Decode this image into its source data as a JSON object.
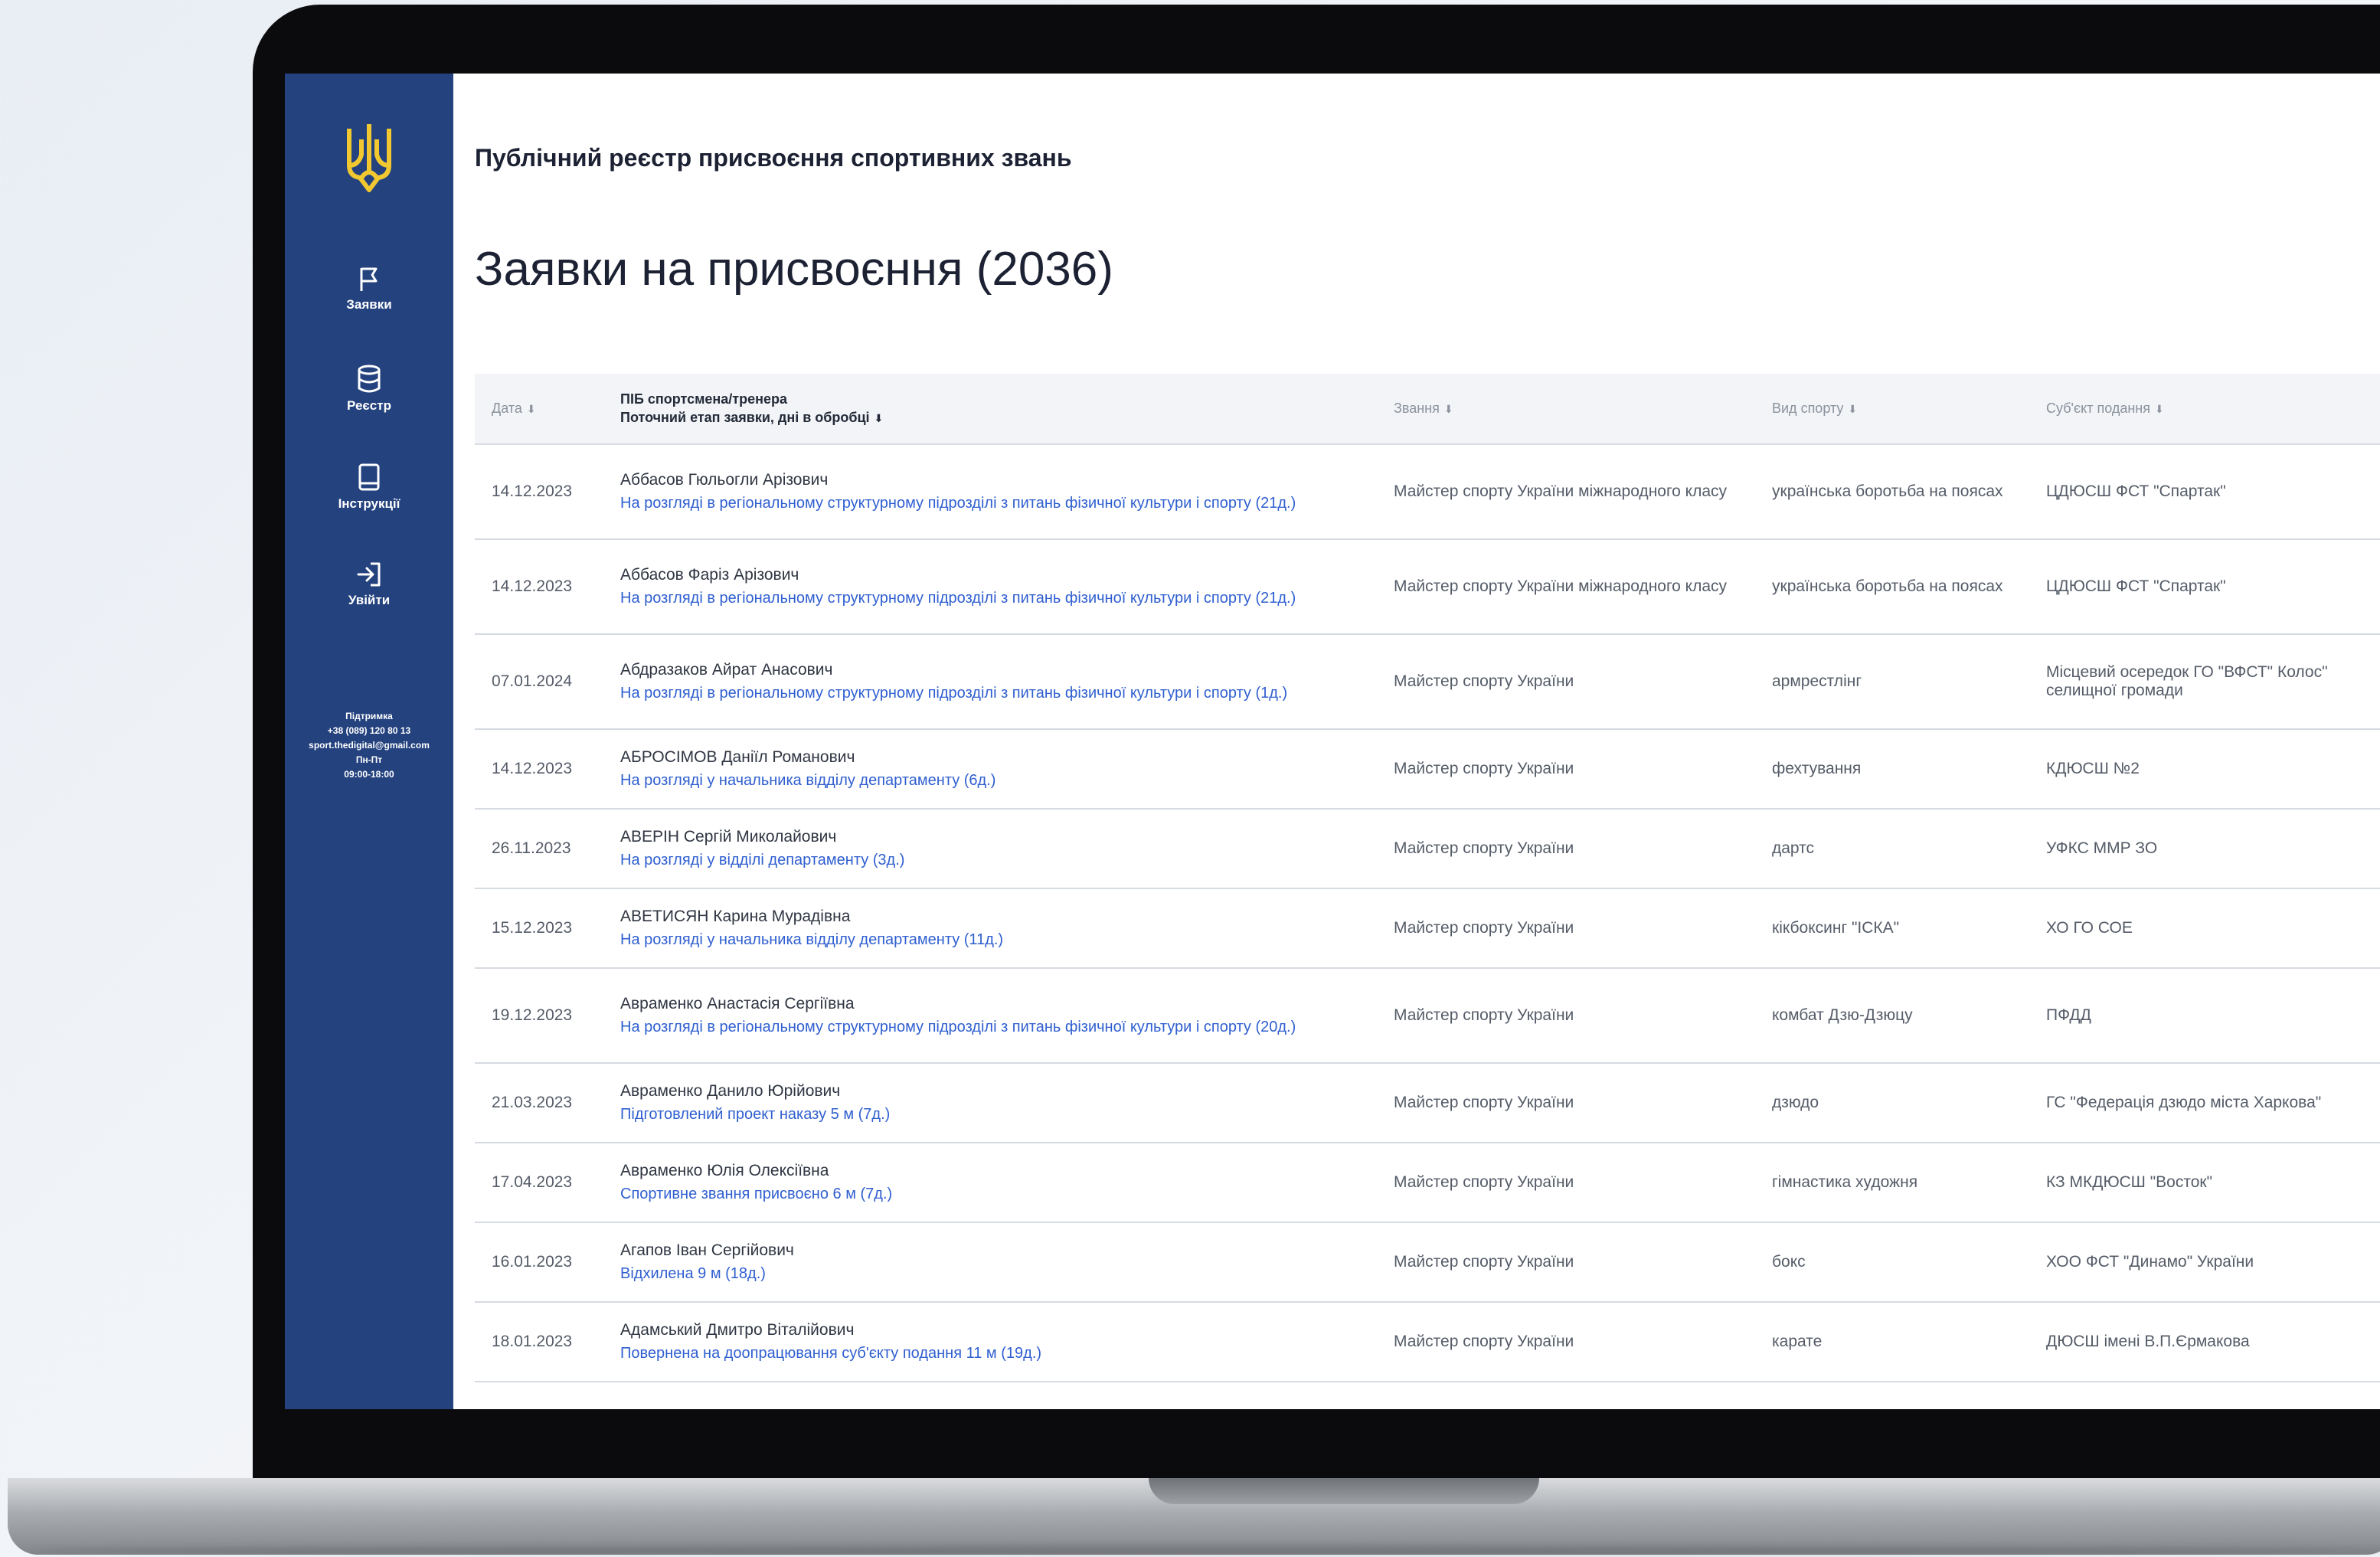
{
  "app": {
    "portal_title": "Публічний реєстр присвоєння спортивних звань",
    "page_title": "Заявки на присвоєння (2036)"
  },
  "colors": {
    "sidebar": "#24427e",
    "logo": "#f2c830",
    "link": "#2f5fd0",
    "header_bg": "#f2f4f7"
  },
  "sidebar": {
    "logo": "coat-of-arms-icon",
    "items": [
      {
        "label": "Заявки",
        "icon": "flag-icon"
      },
      {
        "label": "Реєстр",
        "icon": "database-icon"
      },
      {
        "label": "Інструкції",
        "icon": "book-icon"
      },
      {
        "label": "Увійти",
        "icon": "login-icon"
      }
    ],
    "support": {
      "title": "Підтримка",
      "phone": "+38 (089) 120 80 13",
      "email": "sport.thedigital@gmail.com",
      "days": "Пн-Пт",
      "hours": "09:00-18:00"
    }
  },
  "table": {
    "headers": {
      "date": "Дата",
      "name_line1": "ПІБ спортсмена/тренера",
      "name_line2": "Поточний етап заявки, дні в обробці",
      "rank": "Звання",
      "sport": "Вид спорту",
      "org": "Суб'єкт подання"
    },
    "rows": [
      {
        "date": "14.12.2023",
        "name": "Аббасов Гюльогли Арізович",
        "status": "На розгляді в регіональному структурному підрозділі з питань фізичної культури і спорту (21д.)",
        "rank": "Майстер спорту України міжнародного класу",
        "sport": "українська боротьба на поясах",
        "org": "ЦДЮСШ ФСТ \"Спартак\""
      },
      {
        "date": "14.12.2023",
        "name": "Аббасов Фаріз Арізович",
        "status": "На розгляді в регіональному структурному підрозділі з питань фізичної культури і спорту (21д.)",
        "rank": "Майстер спорту України міжнародного класу",
        "sport": "українська боротьба на поясах",
        "org": "ЦДЮСШ ФСТ \"Спартак\""
      },
      {
        "date": "07.01.2024",
        "name": "Абдразаков Айрат Анасович",
        "status": "На розгляді в регіональному структурному підрозділі з питань фізичної культури і спорту (1д.)",
        "rank": "Майстер спорту України",
        "sport": "армрестлінг",
        "org": "Місцевий осередок ГО \"ВФСТ\" Колос\" селищної громади"
      },
      {
        "date": "14.12.2023",
        "name": "АБРОСІМОВ Даніїл Романович",
        "status": "На розгляді у начальника відділу департаменту (6д.)",
        "rank": "Майстер спорту України",
        "sport": "фехтування",
        "org": "КДЮСШ №2"
      },
      {
        "date": "26.11.2023",
        "name": "АВЕРІН Сергій Миколайович",
        "status": "На розгляді у відділі департаменту (3д.)",
        "rank": "Майстер спорту України",
        "sport": "дартс",
        "org": "УФКС ММР ЗО"
      },
      {
        "date": "15.12.2023",
        "name": "АВЕТИСЯН Карина Мурадівна",
        "status": "На розгляді у начальника відділу департаменту (11д.)",
        "rank": "Майстер спорту України",
        "sport": "кікбоксинг \"ІСКА\"",
        "org": "ХО ГО СОЕ"
      },
      {
        "date": "19.12.2023",
        "name": "Авраменко Анастасія Сергіївна",
        "status": "На розгляді в регіональному структурному підрозділі з питань фізичної культури і спорту (20д.)",
        "rank": "Майстер спорту України",
        "sport": "комбат Дзю-Дзюцу",
        "org": "ПФДД"
      },
      {
        "date": "21.03.2023",
        "name": "Авраменко Данило Юрійович",
        "status": "Підготовлений проект наказу 5 м (7д.)",
        "rank": "Майстер спорту України",
        "sport": "дзюдо",
        "org": "ГС \"Федерація дзюдо міста Харкова\""
      },
      {
        "date": "17.04.2023",
        "name": "Авраменко Юлія Олексіївна",
        "status": "Спортивне звання присвоєно 6 м (7д.)",
        "rank": "Майстер спорту України",
        "sport": "гімнастика художня",
        "org": "КЗ МКДЮСШ \"Восток\""
      },
      {
        "date": "16.01.2023",
        "name": "Агапов Іван Сергійович",
        "status": "Відхилена 9 м (18д.)",
        "rank": "Майстер спорту України",
        "sport": "бокс",
        "org": "ХОО ФСТ \"Динамо\" України"
      },
      {
        "date": "18.01.2023",
        "name": "Адамський Дмитро Віталійович",
        "status": "Повернена на доопрацювання суб'єкту подання 11 м (19д.)",
        "rank": "Майстер спорту України",
        "sport": "карате",
        "org": "ДЮСШ імені В.П.Єрмакова"
      }
    ]
  }
}
